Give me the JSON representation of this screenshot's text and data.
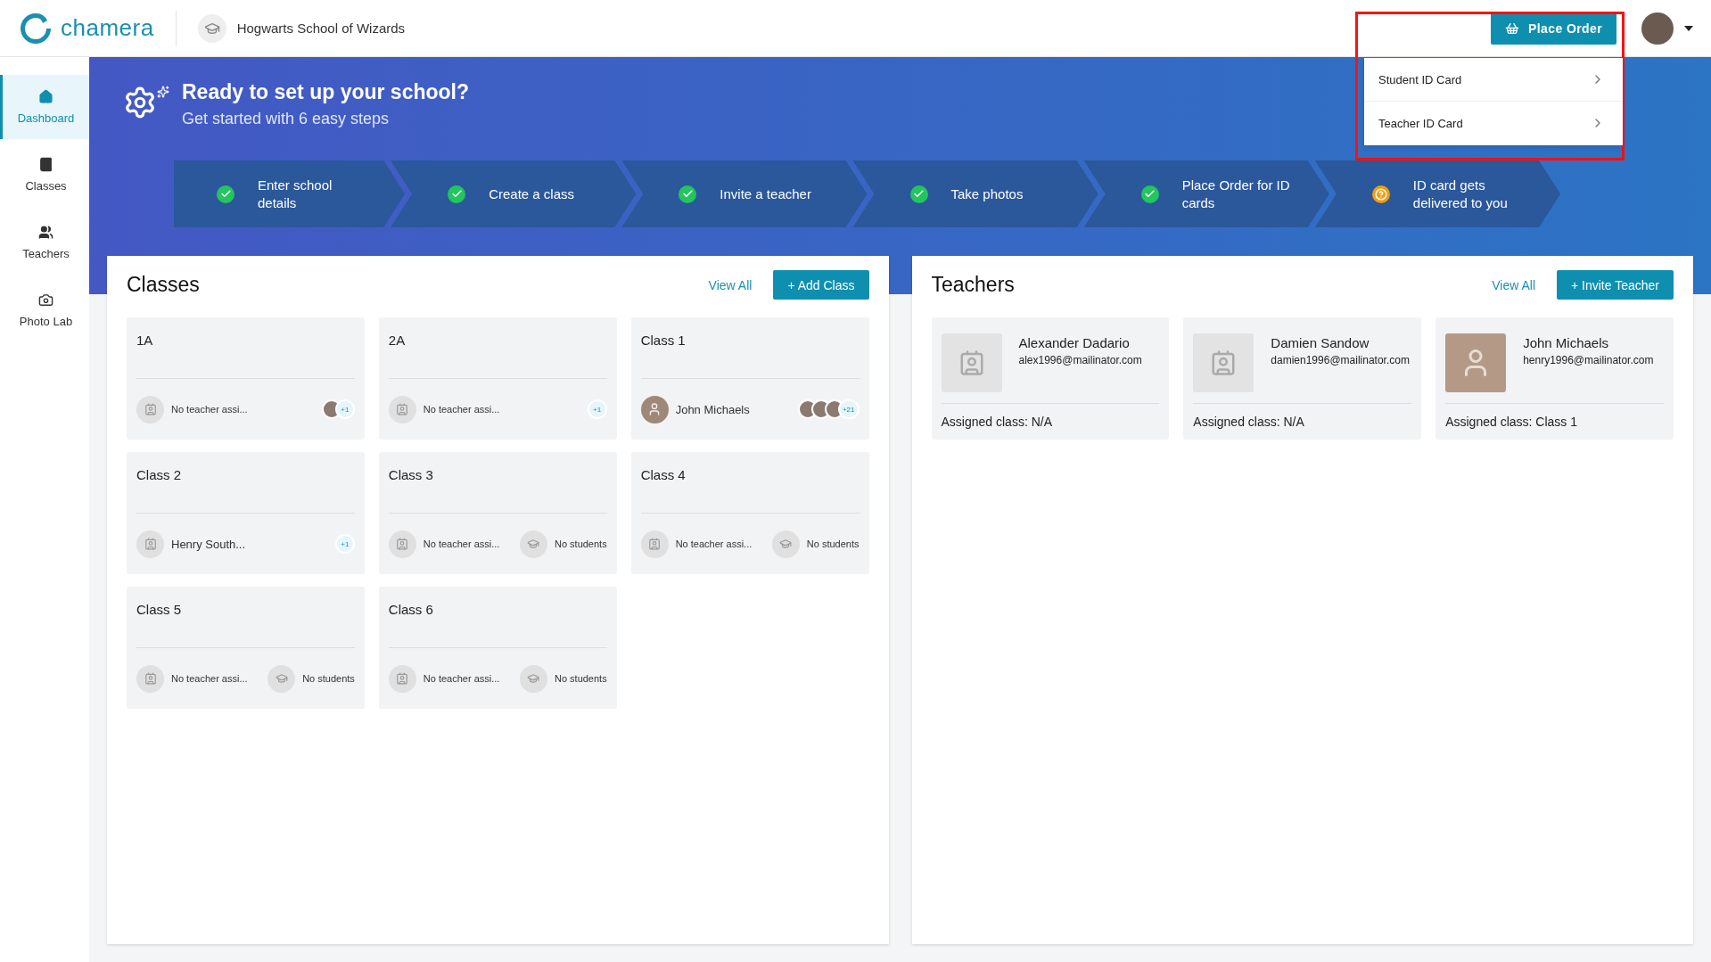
{
  "brand": {
    "name": "chamera"
  },
  "school": {
    "name": "Hogwarts School of Wizards"
  },
  "place_order": {
    "label": "Place Order",
    "menu": [
      {
        "label": "Student ID Card"
      },
      {
        "label": "Teacher ID Card"
      }
    ]
  },
  "sidebar": {
    "items": [
      {
        "label": "Dashboard",
        "selected": true
      },
      {
        "label": "Classes",
        "selected": false
      },
      {
        "label": "Teachers",
        "selected": false
      },
      {
        "label": "Photo Lab",
        "selected": false
      }
    ]
  },
  "banner": {
    "title": "Ready to set up your school?",
    "subtitle": "Get started with 6 easy steps",
    "steps": [
      {
        "label": "Enter school details",
        "done": true
      },
      {
        "label": "Create a class",
        "done": true
      },
      {
        "label": "Invite a teacher",
        "done": true
      },
      {
        "label": "Take photos",
        "done": true
      },
      {
        "label": "Place Order for ID cards",
        "done": true
      },
      {
        "label": "ID card gets delivered to you",
        "done": false
      }
    ]
  },
  "classes": {
    "title": "Classes",
    "view_all": "View All",
    "add": "+ Add Class",
    "items": [
      {
        "name": "1A",
        "teacher": {
          "kind": "none",
          "text": "No teacher assi..."
        },
        "students": {
          "kind": "avatars",
          "photos": [
            {
              "kind": "photo"
            }
          ],
          "count": "+1"
        }
      },
      {
        "name": "2A",
        "teacher": {
          "kind": "none",
          "text": "No teacher assi..."
        },
        "students": {
          "kind": "avatars",
          "count": "+1"
        }
      },
      {
        "name": "Class 1",
        "teacher": {
          "kind": "photo",
          "text": "John Michaels"
        },
        "students": {
          "kind": "avatars",
          "photos": [
            {
              "kind": "photo"
            },
            {
              "kind": "photo"
            },
            {
              "kind": "photo"
            }
          ],
          "count": "+21"
        }
      },
      {
        "name": "Class 2",
        "teacher": {
          "kind": "placeholder",
          "text": "Henry South..."
        },
        "students": {
          "kind": "avatars",
          "count": "+1"
        }
      },
      {
        "name": "Class 3",
        "teacher": {
          "kind": "none",
          "text": "No teacher assi..."
        },
        "students": {
          "kind": "none",
          "text": "No students"
        }
      },
      {
        "name": "Class 4",
        "teacher": {
          "kind": "none",
          "text": "No teacher assi..."
        },
        "students": {
          "kind": "none",
          "text": "No students"
        }
      },
      {
        "name": "Class 5",
        "teacher": {
          "kind": "none",
          "text": "No teacher assi..."
        },
        "students": {
          "kind": "none",
          "text": "No students"
        }
      },
      {
        "name": "Class 6",
        "teacher": {
          "kind": "none",
          "text": "No teacher assi..."
        },
        "students": {
          "kind": "none",
          "text": "No students"
        }
      }
    ]
  },
  "teachers": {
    "title": "Teachers",
    "view_all": "View All",
    "add": "+ Invite Teacher",
    "items": [
      {
        "name": "Alexander Dadario",
        "email": "alex1996@mailinator.com",
        "assigned": "Assigned class: N/A",
        "kind": "placeholder"
      },
      {
        "name": "Damien Sandow",
        "email": "damien1996@mailinator.com",
        "assigned": "Assigned class: N/A",
        "kind": "placeholder"
      },
      {
        "name": "John Michaels",
        "email": "henry1996@mailinator.com",
        "assigned": "Assigned class: Class 1",
        "kind": "photo"
      }
    ]
  }
}
